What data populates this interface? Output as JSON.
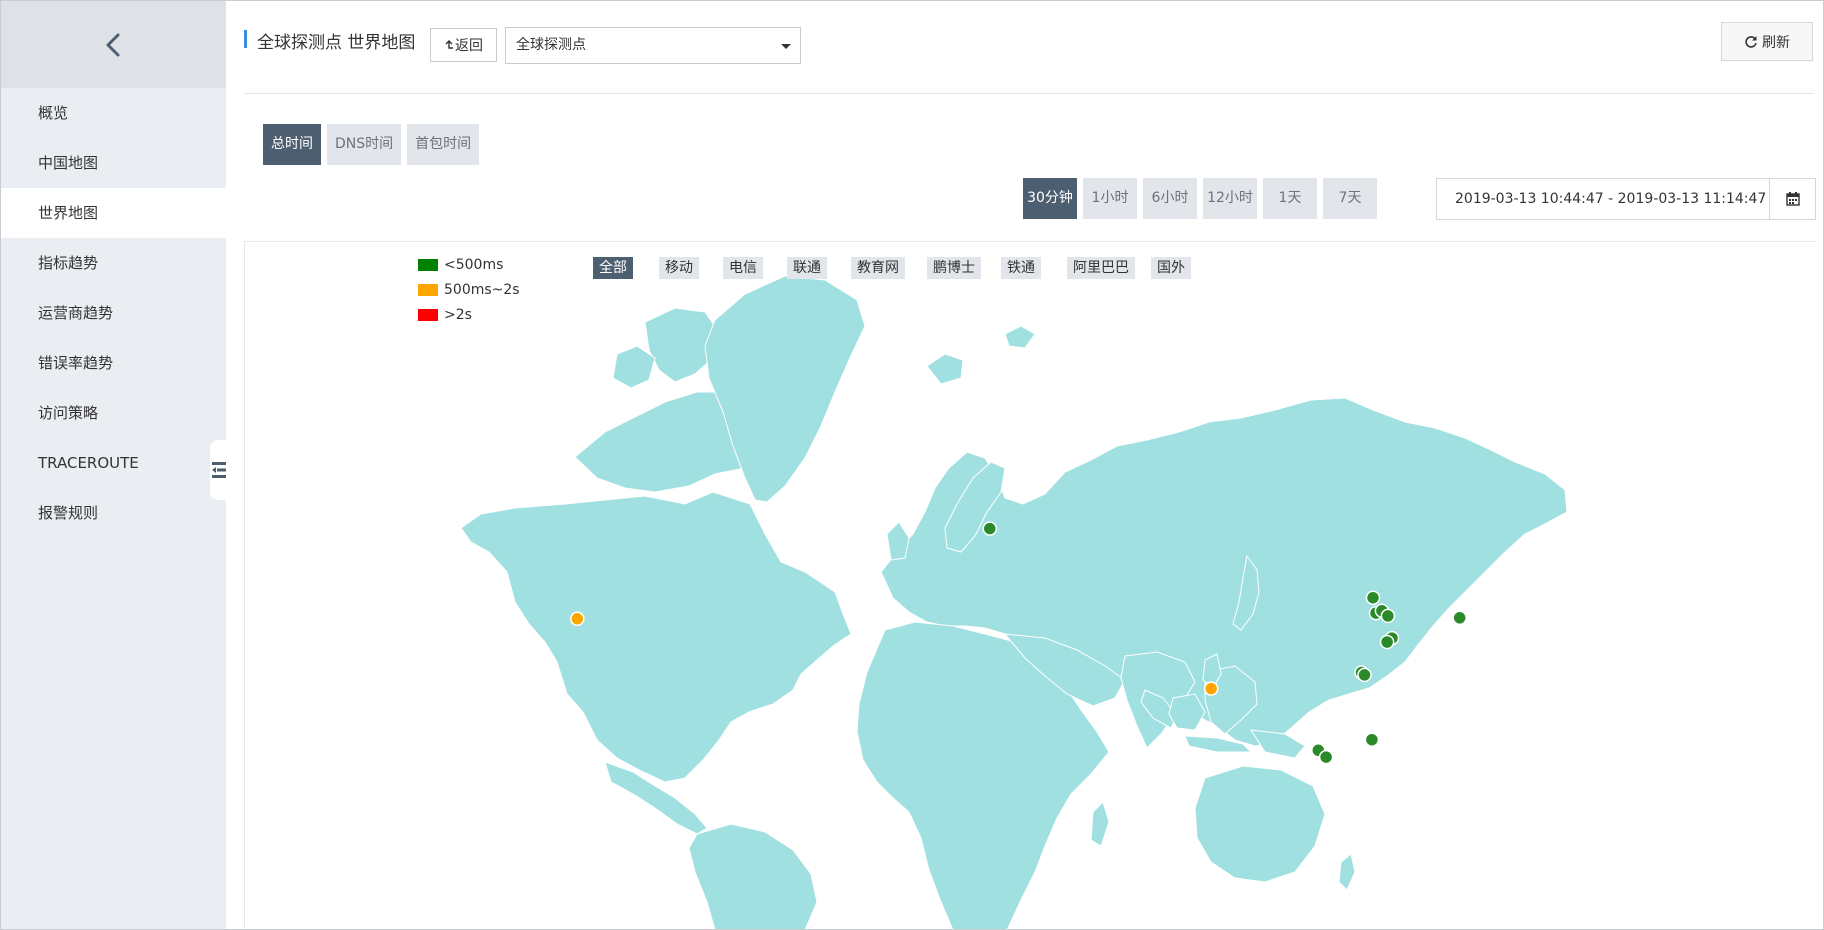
{
  "sidebar": {
    "back_icon": "chevron-left-icon",
    "items": [
      {
        "label": "概览",
        "active": false
      },
      {
        "label": "中国地图",
        "active": false
      },
      {
        "label": "世界地图",
        "active": true
      },
      {
        "label": "指标趋势",
        "active": false
      },
      {
        "label": "运营商趋势",
        "active": false
      },
      {
        "label": "错误率趋势",
        "active": false
      },
      {
        "label": "访问策略",
        "active": false
      },
      {
        "label": "TRACEROUTE",
        "active": false
      },
      {
        "label": "报警规则",
        "active": false
      }
    ]
  },
  "header": {
    "title": "全球探测点 世界地图",
    "back_label": "返回",
    "probe_select_value": "全球探测点",
    "refresh_label": "刷新"
  },
  "metric_tabs": [
    {
      "label": "总时间",
      "active": true
    },
    {
      "label": "DNS时间",
      "active": false
    },
    {
      "label": "首包时间",
      "active": false
    }
  ],
  "time_range": {
    "options": [
      {
        "label": "30分钟",
        "active": true
      },
      {
        "label": "1小时",
        "active": false
      },
      {
        "label": "6小时",
        "active": false
      },
      {
        "label": "12小时",
        "active": false
      },
      {
        "label": "1天",
        "active": false
      },
      {
        "label": "7天",
        "active": false
      }
    ],
    "value": "2019-03-13 10:44:47 - 2019-03-13 11:14:47"
  },
  "map": {
    "legend": [
      {
        "label": "<500ms",
        "color": "#008000"
      },
      {
        "label": "500ms~2s",
        "color": "#ffa500"
      },
      {
        "label": ">2s",
        "color": "#ff0000"
      }
    ],
    "isp_filters": [
      {
        "label": "全部",
        "active": true
      },
      {
        "label": "移动",
        "active": false
      },
      {
        "label": "电信",
        "active": false
      },
      {
        "label": "联通",
        "active": false
      },
      {
        "label": "教育网",
        "active": false
      },
      {
        "label": "鹏博士",
        "active": false
      },
      {
        "label": "铁通",
        "active": false
      },
      {
        "label": "阿里巴巴",
        "active": false
      },
      {
        "label": "国外",
        "active": false
      }
    ],
    "land_color": "#a0e0e0",
    "probe_points": [
      {
        "lon": 13.4,
        "lat": 52.5,
        "level": "ok"
      },
      {
        "lon": -97.5,
        "lat": 35.5,
        "level": "warn"
      },
      {
        "lon": 72.9,
        "lat": 19.1,
        "level": "warn"
      },
      {
        "lon": 116.4,
        "lat": 39.9,
        "level": "ok"
      },
      {
        "lon": 117.2,
        "lat": 36.7,
        "level": "ok"
      },
      {
        "lon": 118.8,
        "lat": 37.2,
        "level": "ok"
      },
      {
        "lon": 120.4,
        "lat": 36.1,
        "level": "ok"
      },
      {
        "lon": 121.5,
        "lat": 31.2,
        "level": "ok"
      },
      {
        "lon": 120.2,
        "lat": 30.3,
        "level": "ok"
      },
      {
        "lon": 113.3,
        "lat": 23.1,
        "level": "ok"
      },
      {
        "lon": 114.1,
        "lat": 22.5,
        "level": "ok"
      },
      {
        "lon": 139.7,
        "lat": 35.7,
        "level": "ok"
      },
      {
        "lon": 101.7,
        "lat": 3.1,
        "level": "ok"
      },
      {
        "lon": 103.8,
        "lat": 1.3,
        "level": "ok"
      },
      {
        "lon": 116.1,
        "lat": 5.9,
        "level": "ok"
      }
    ]
  }
}
